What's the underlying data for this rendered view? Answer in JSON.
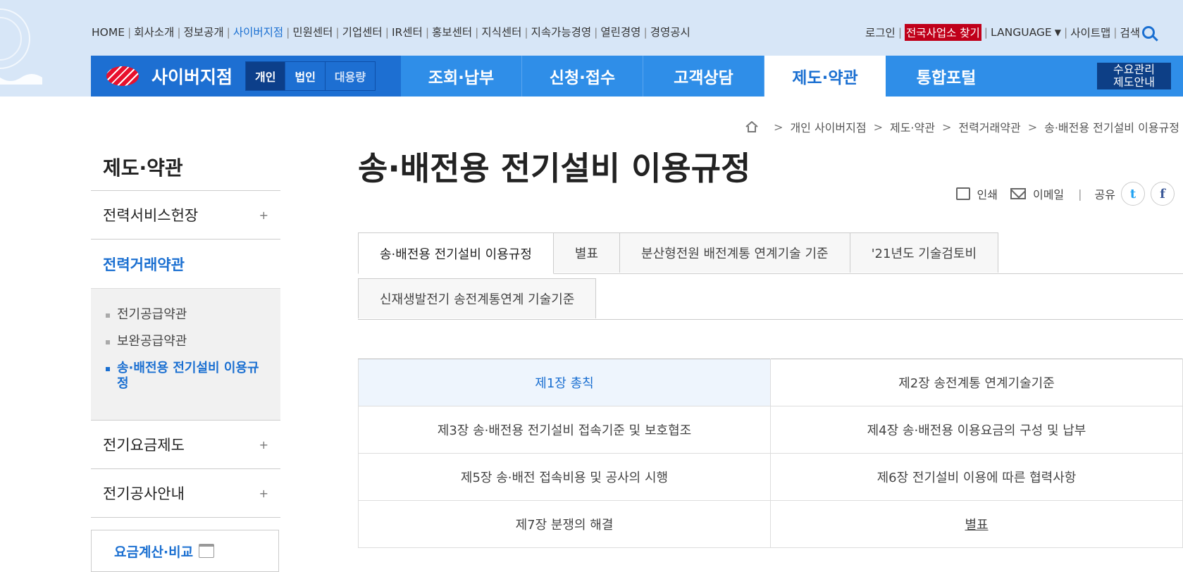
{
  "top_nav": [
    "HOME",
    "회사소개",
    "정보공개",
    "사이버지점",
    "민원센터",
    "기업센터",
    "IR센터",
    "홍보센터",
    "지식센터",
    "지속가능경영",
    "열린경영",
    "경영공시"
  ],
  "top_nav_active": "사이버지점",
  "util_nav": {
    "login": "로그인",
    "find_office": "전국사업소 찾기",
    "language": "LANGUAGE",
    "sitemap": "사이트맵",
    "search": "검색"
  },
  "brand": {
    "name": "사이버지점",
    "segments": [
      "개인",
      "법인",
      "대용량"
    ],
    "active_segment": "개인"
  },
  "main_menu": [
    "조회·납부",
    "신청·접수",
    "고객상담",
    "제도·약관",
    "통합포털"
  ],
  "main_menu_active": "제도·약관",
  "demand_button": "수요관리\n제도안내",
  "breadcrumb": [
    "개인 사이버지점",
    "제도·약관",
    "전력거래약관",
    "송·배전용 전기설비 이용규정"
  ],
  "sidebar": {
    "title": "제도·약관",
    "items": [
      {
        "label": "전력서비스헌장",
        "expandable": true
      },
      {
        "label": "전력거래약관",
        "expandable": false,
        "active": true
      },
      {
        "label": "전기요금제도",
        "expandable": true
      },
      {
        "label": "전기공사안내",
        "expandable": true
      }
    ],
    "sub_items": [
      "전기공급약관",
      "보완공급약관",
      "송·배전용 전기설비 이용규정"
    ],
    "sub_active": "송·배전용 전기설비 이용규정",
    "calc_box": "요금계산·비교",
    "plus_symbol": "+"
  },
  "page_title": "송·배전용 전기설비 이용규정",
  "tools": {
    "print": "인쇄",
    "email": "이메일",
    "share": "공유",
    "twitter": "t",
    "facebook": "f"
  },
  "tabs_row1": [
    "송·배전용 전기설비 이용규정",
    "별표",
    "분산형전원 배전계통 연계기술 기준",
    "'21년도 기술검토비"
  ],
  "tabs_row2": [
    "신재생발전기 송전계통연계 기술기준"
  ],
  "tab_active": "송·배전용 전기설비 이용규정",
  "chapters": [
    [
      "제1장 총칙",
      "제2장 송전계통 연계기술기준"
    ],
    [
      "제3장 송·배전용 전기설비 접속기준 및 보호협조",
      "제4장 송·배전용 이용요금의 구성 및 납부"
    ],
    [
      "제5장 송·배전 접속비용 및 공사의 시행",
      "제6장 전기설비 이용에 따른 협력사항"
    ],
    [
      "제7장 분쟁의 해결",
      "별표"
    ]
  ],
  "chapter_active": "제1장 총칙",
  "colors": {
    "primary_blue": "#2f8ee8",
    "dark_blue": "#1d6fd2",
    "accent_red": "#c0001a",
    "header_bg": "#d7e6f7",
    "link_blue": "#1a6fd1"
  }
}
